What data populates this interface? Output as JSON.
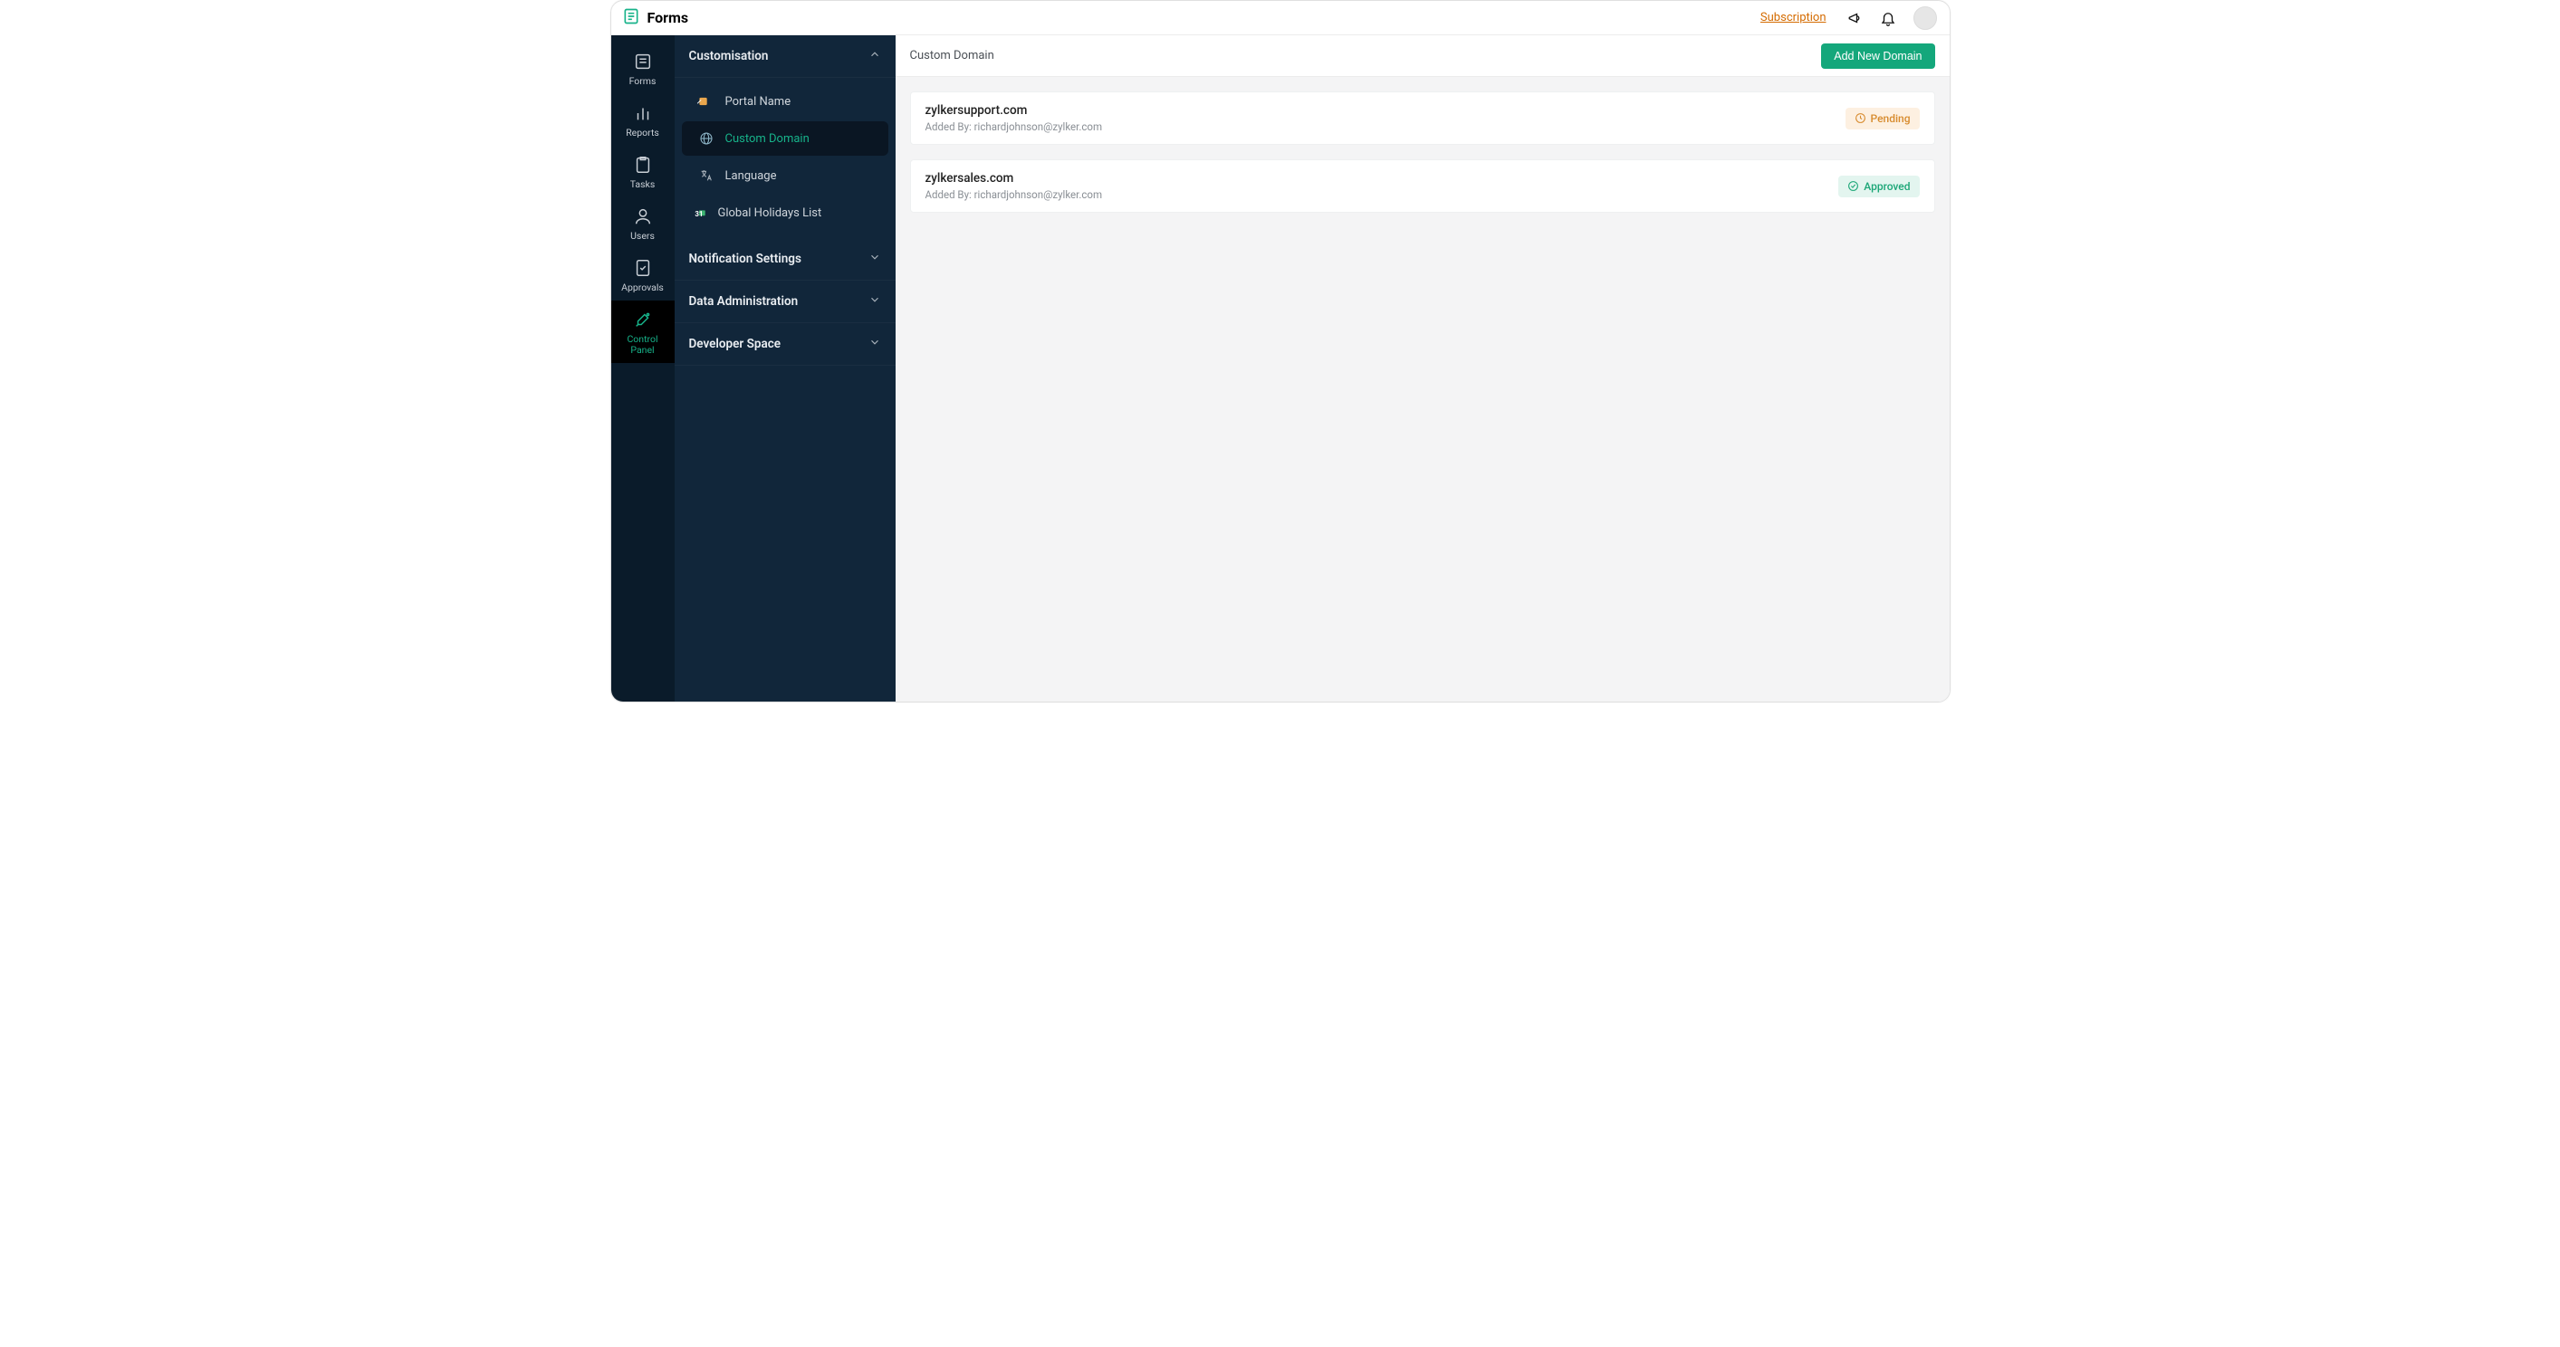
{
  "header": {
    "app_name": "Forms",
    "subscription_link": "Subscription"
  },
  "rail": {
    "items": [
      {
        "label": "Forms"
      },
      {
        "label": "Reports"
      },
      {
        "label": "Tasks"
      },
      {
        "label": "Users"
      },
      {
        "label": "Approvals"
      },
      {
        "label": "Control\nPanel"
      }
    ]
  },
  "sidebar": {
    "sections": [
      {
        "title": "Customisation",
        "expanded": true,
        "items": [
          {
            "label": "Portal Name"
          },
          {
            "label": "Custom Domain"
          },
          {
            "label": "Language"
          },
          {
            "label": "Global Holidays List"
          }
        ]
      },
      {
        "title": "Notification Settings",
        "expanded": false
      },
      {
        "title": "Data Administration",
        "expanded": false
      },
      {
        "title": "Developer Space",
        "expanded": false
      }
    ]
  },
  "main": {
    "page_title": "Custom Domain",
    "add_button": "Add New Domain",
    "domains": [
      {
        "name": "zylkersupport.com",
        "added_by_prefix": "Added By: ",
        "added_by": "richardjohnson@zylker.com",
        "status_label": "Pending",
        "status": "pending"
      },
      {
        "name": "zylkersales.com",
        "added_by_prefix": "Added By: ",
        "added_by": "richardjohnson@zylker.com",
        "status_label": "Approved",
        "status": "approved"
      }
    ]
  }
}
